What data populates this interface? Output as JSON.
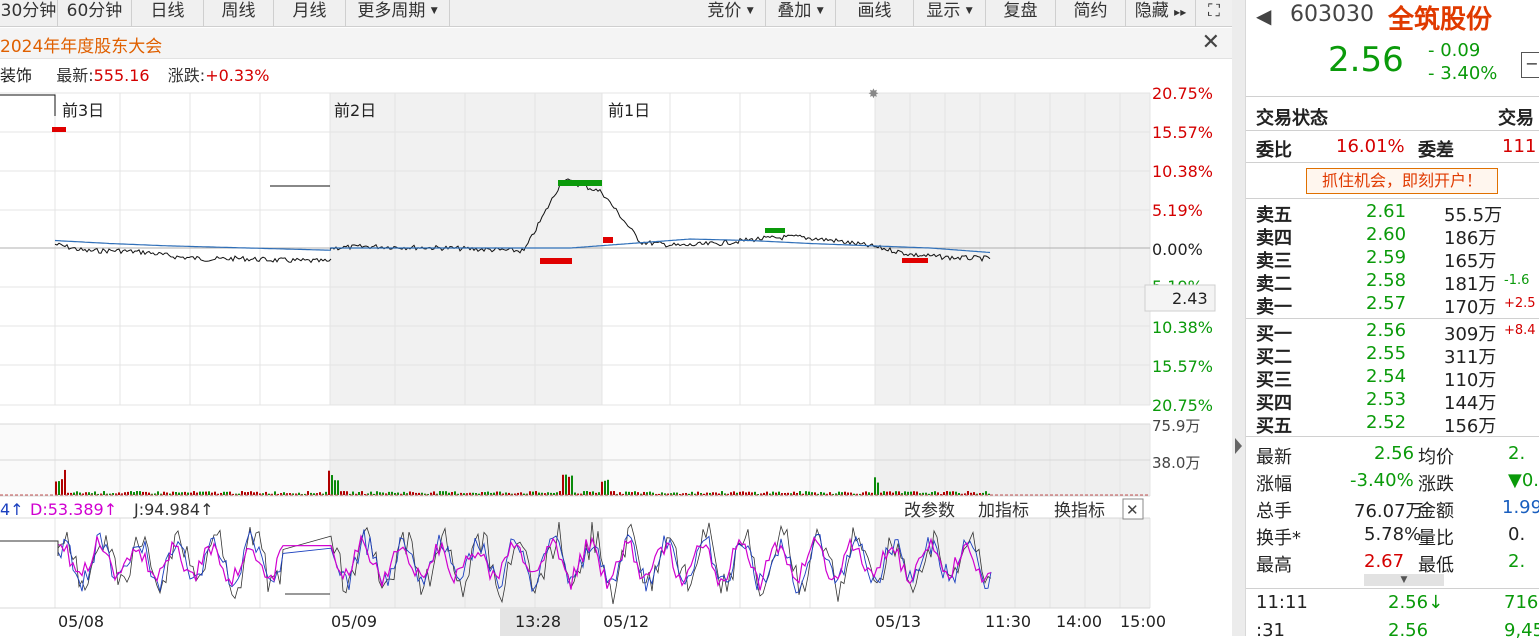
{
  "toolbar": {
    "left_buttons": [
      "30分钟",
      "60分钟",
      "日线",
      "周线",
      "月线",
      "更多周期"
    ],
    "right_buttons": [
      "竞价",
      "叠加",
      "画线",
      "显示",
      "复盘",
      "简约",
      "隐藏"
    ],
    "dropdown_marker": "▼",
    "hide_arrows": "▸▸",
    "fullscreen_glyph": "⛶"
  },
  "banner": {
    "title": "2024年年度股东大会",
    "close": "✕"
  },
  "index_info": {
    "name": "装饰",
    "latest_label": "最新:",
    "latest_value": "555.16",
    "change_label": "涨跌:",
    "change_value": "+0.33%"
  },
  "chart": {
    "day_labels": [
      "前3日",
      "前2日",
      "前1日"
    ],
    "pct_labels": [
      "20.75%",
      "15.57%",
      "10.38%",
      "5.19%",
      "0.00%",
      "5.19%",
      "10.38%",
      "15.57%",
      "20.75%"
    ],
    "price_tag": "2.43",
    "volume_labels": [
      "75.9万",
      "38.0万"
    ],
    "kdj": {
      "k_text": "4↑",
      "d_text": "D:53.389↑",
      "j_text": "J:94.984↑"
    },
    "indicator_buttons": [
      "改参数",
      "加指标",
      "换指标"
    ],
    "indicator_close": "✕",
    "date_labels": [
      "05/08",
      "05/09",
      "13:28",
      "05/12",
      "05/13",
      "11:30",
      "14:00",
      "15:00"
    ],
    "crosshair_icon": "✸"
  },
  "chart_data": {
    "type": "line",
    "series": [
      {
        "values": [
          0.5,
          -0.4,
          -0.35,
          -0.6,
          -1.2,
          -1.5,
          -1.4,
          -1.6,
          -1.7,
          -1.8
        ]
      },
      {
        "values": [
          0.0,
          0.2,
          0.1,
          0.0,
          -0.2,
          -0.4,
          9.2,
          7.5,
          0.8,
          0.3,
          0.6,
          1.2,
          1.5,
          1.0,
          0.2,
          -0.9,
          -1.3,
          -1.4
        ]
      }
    ]
  },
  "quote": {
    "code": "603030",
    "name": "全筑股份",
    "price": "2.56",
    "change": "- 0.09",
    "change_pct": "- 3.40%",
    "back_icon": "◀",
    "minus_icon": "−",
    "status_label": "交易状态",
    "status_label2": "交易",
    "webi_label": "委比",
    "webi_value": "16.01%",
    "weicha_label": "委差",
    "weicha_value": "111",
    "promo": "抓住机会，即刻开户！",
    "asks": [
      {
        "label": "卖五",
        "price": "2.61",
        "vol": "55.5万",
        "extra": ""
      },
      {
        "label": "卖四",
        "price": "2.60",
        "vol": "186万",
        "extra": ""
      },
      {
        "label": "卖三",
        "price": "2.59",
        "vol": "165万",
        "extra": ""
      },
      {
        "label": "卖二",
        "price": "2.58",
        "vol": "181万",
        "extra": "-1.6"
      },
      {
        "label": "卖一",
        "price": "2.57",
        "vol": "170万",
        "extra": "+2.5"
      }
    ],
    "bids": [
      {
        "label": "买一",
        "price": "2.56",
        "vol": "309万",
        "extra": "+8.4"
      },
      {
        "label": "买二",
        "price": "2.55",
        "vol": "311万",
        "extra": ""
      },
      {
        "label": "买三",
        "price": "2.54",
        "vol": "110万",
        "extra": ""
      },
      {
        "label": "买四",
        "price": "2.53",
        "vol": "144万",
        "extra": ""
      },
      {
        "label": "买五",
        "price": "2.52",
        "vol": "156万",
        "extra": ""
      }
    ],
    "stats": [
      {
        "l1": "最新",
        "v1": "2.56",
        "l2": "均价",
        "v2": "2."
      },
      {
        "l1": "涨幅",
        "v1": "-3.40%",
        "l2": "涨跌",
        "v2": "▼0."
      },
      {
        "l1": "总手",
        "v1": "76.07万",
        "l2": "金额",
        "v2": "1.99"
      },
      {
        "l1": "换手*",
        "v1": "5.78%",
        "l2": "量比",
        "v2": "0."
      },
      {
        "l1": "最高",
        "v1": "2.67",
        "l2": "最低",
        "v2": "2."
      }
    ],
    "expand_icon": "▼",
    "ticks": [
      {
        "time": "11:11",
        "price": "2.56↓",
        "vol": "716"
      },
      {
        "time": ":31",
        "price": "2.56",
        "vol": "9,45"
      }
    ]
  }
}
